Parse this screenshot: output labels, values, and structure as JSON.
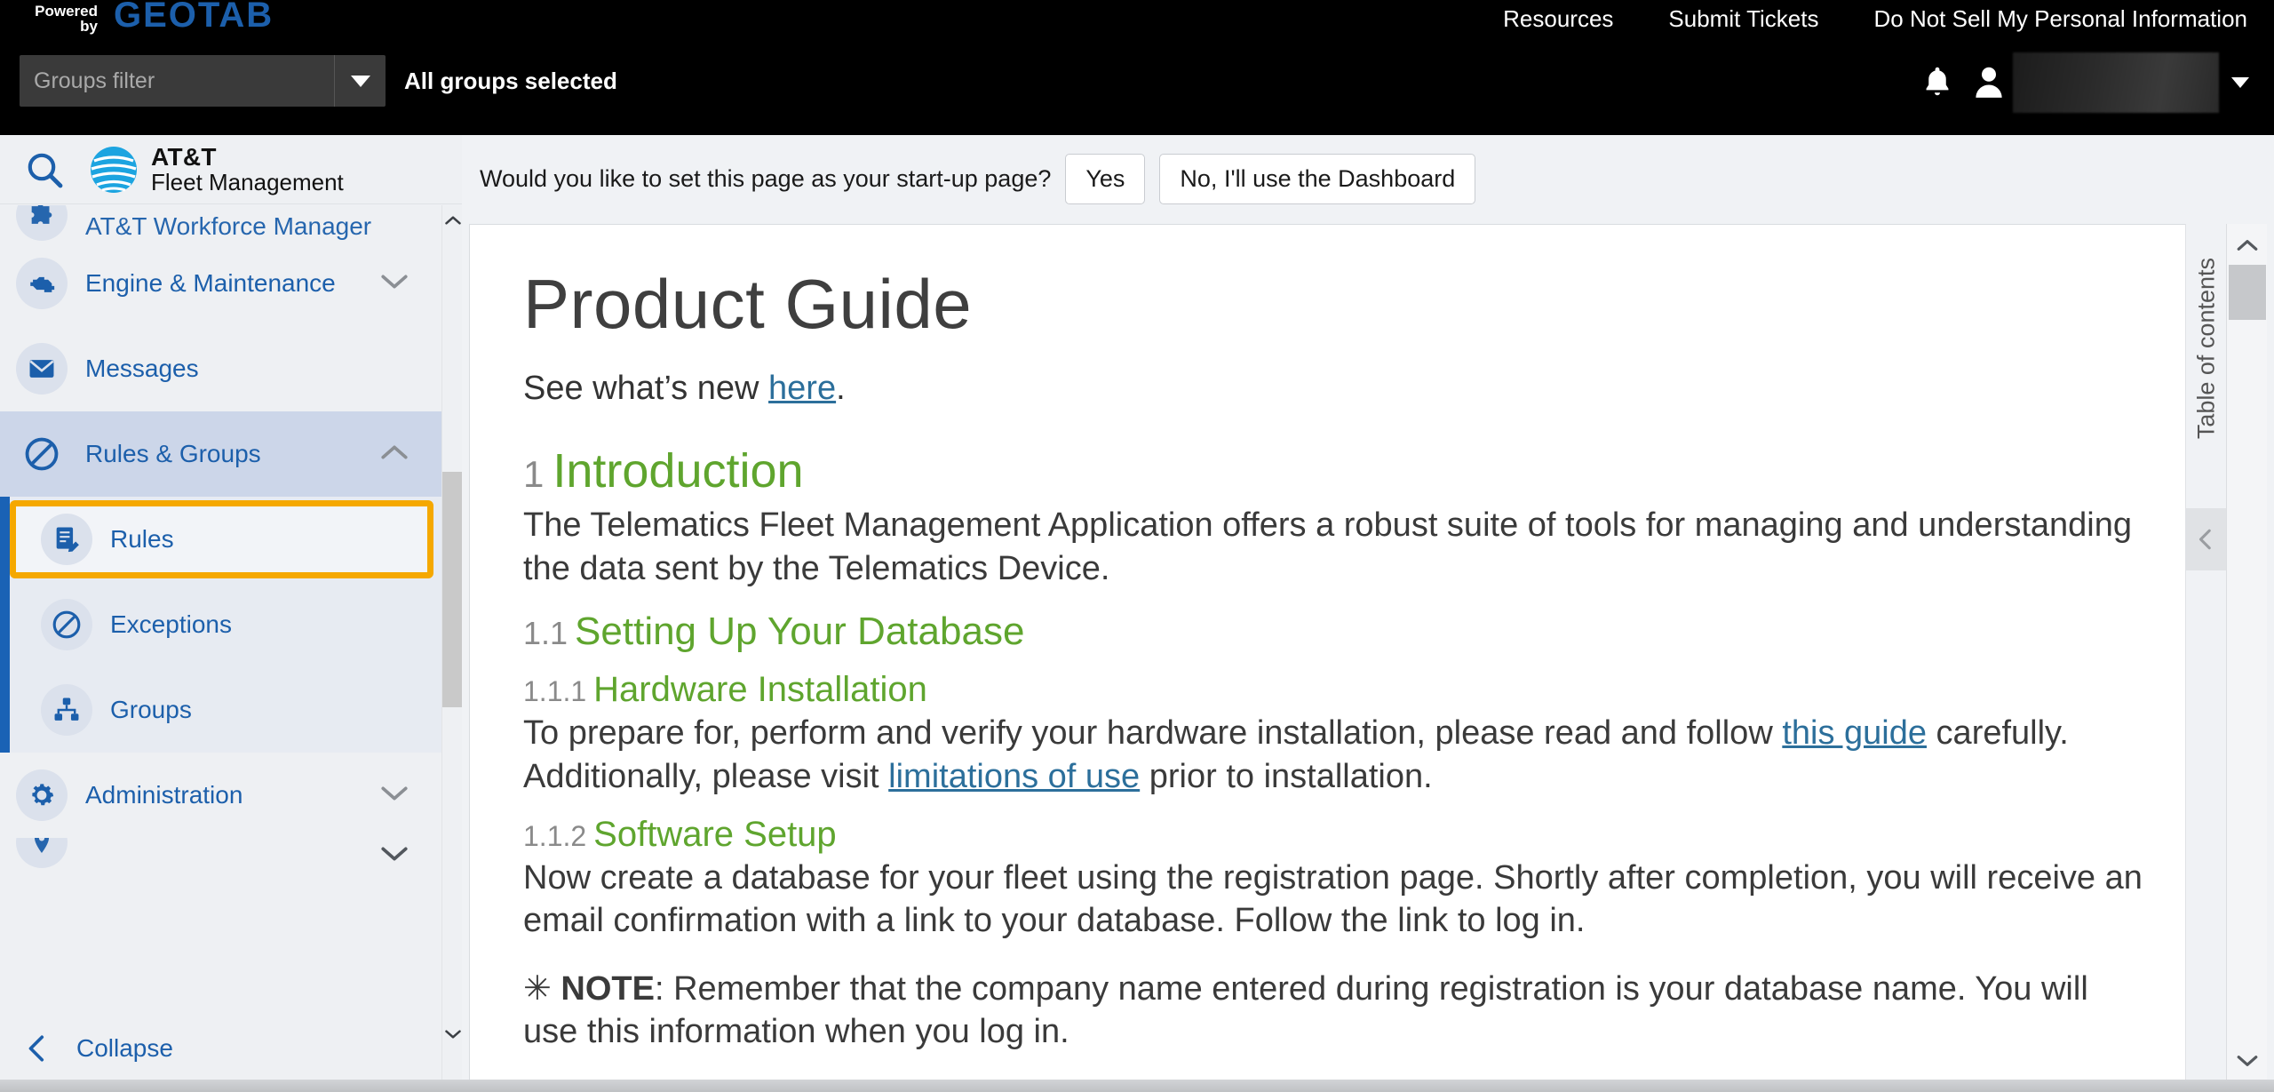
{
  "topbar": {
    "powered_line1": "Powered",
    "powered_line2": "by",
    "brand": "GEOTAB",
    "groups_filter_placeholder": "Groups filter",
    "groups_filter_value": "",
    "groups_selected": "All groups selected",
    "links": [
      {
        "label": "Resources",
        "name": "resources-link"
      },
      {
        "label": "Submit Tickets",
        "name": "submit-tickets-link"
      },
      {
        "label": "Do Not Sell My Personal Information",
        "name": "do-not-sell-link"
      }
    ],
    "bell_icon": "bell-icon",
    "person_icon": "person-icon",
    "user_name": "",
    "user_caret": "chevron-down-icon"
  },
  "sidebar": {
    "search_icon": "search-icon",
    "logo": {
      "icon": "att-globe-icon",
      "line1": "AT&T",
      "line2": "Fleet Management"
    },
    "items": [
      {
        "label": "AT&T Workforce Manager",
        "icon": "puzzle-icon",
        "state": "clipped"
      },
      {
        "label": "Engine & Maintenance",
        "icon": "engine-icon",
        "chevron": "chevron-down-icon"
      },
      {
        "label": "Messages",
        "icon": "envelope-icon"
      },
      {
        "label": "Rules & Groups",
        "icon": "rules-circle-icon",
        "chevron": "chevron-up-icon",
        "state": "expanded"
      }
    ],
    "sub_items": [
      {
        "label": "Rules",
        "icon": "rules-document-icon",
        "focused": true
      },
      {
        "label": "Exceptions",
        "icon": "exception-icon",
        "focused": false
      },
      {
        "label": "Groups",
        "icon": "groups-hierarchy-icon",
        "focused": false
      }
    ],
    "items_after": [
      {
        "label": "Administration",
        "icon": "gear-icon",
        "chevron": "chevron-down-icon"
      },
      {
        "label": "",
        "icon": "map-pin-icon",
        "chevron": "chevron-down-icon",
        "state": "clipped"
      }
    ],
    "collapse": {
      "label": "Collapse",
      "icon": "chevron-left-icon"
    }
  },
  "startup_prompt": {
    "question": "Would you like to set this page as your start-up page?",
    "yes_label": "Yes",
    "no_label": "No, I'll use the Dashboard"
  },
  "document": {
    "title": "Product Guide",
    "subline_prefix": "See what’s new ",
    "subline_link": "here",
    "subline_suffix": ".",
    "sections": [
      {
        "level": 1,
        "num": "1",
        "heading": "Introduction",
        "paragraphs": [
          "The Telematics Fleet Management Application offers a robust suite of tools for managing and understanding the data sent by the Telematics Device."
        ]
      },
      {
        "level": 2,
        "num": "1.1",
        "heading": "Setting Up Your Database",
        "paragraphs": []
      },
      {
        "level": 3,
        "num": "1.1.1",
        "heading": "Hardware Installation",
        "paragraphs": [
          "To prepare for, perform and verify your hardware installation, please read and follow this guide carefully. Additionally, please visit limitations of use prior to installation."
        ],
        "links": [
          "this guide",
          "limitations of use"
        ]
      },
      {
        "level": 3,
        "num": "1.1.2",
        "heading": "Software Setup",
        "paragraphs": [
          "Now create a database for your fleet using the registration page. Shortly after completion, you will receive an email confirmation with a link to your database. Follow the link to log in."
        ]
      }
    ],
    "note": {
      "star": "✳",
      "label": "NOTE",
      "text": ": Remember that the company name entered during registration is your database name. You will use this information when you log in."
    },
    "hardware_para": {
      "p1": "To prepare for, perform and verify your hardware installation, please read and follow ",
      "link1": "this guide",
      "p2": " carefully. Additionally, please visit ",
      "link2": "limitations of use",
      "p3": " prior to installation."
    },
    "toc_label": "Table of contents",
    "toc_toggle_icon": "chevron-left-icon"
  },
  "colors": {
    "brand_blue": "#1c5fab",
    "heading_green": "#5fa52e",
    "link_blue": "#2c6f9b",
    "focus_orange": "#f5a800",
    "accent_bar_blue": "#1a62b5"
  }
}
